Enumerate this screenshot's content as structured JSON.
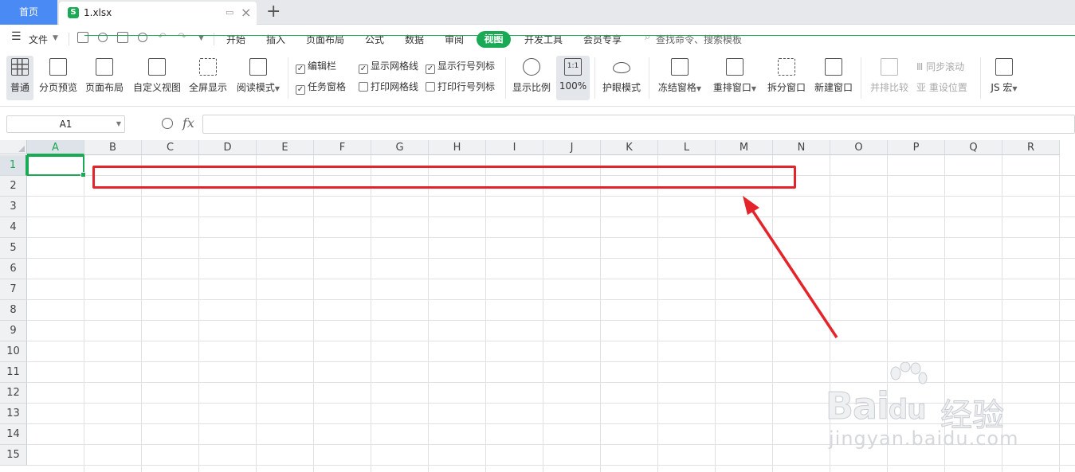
{
  "tabs": {
    "home": "首页",
    "file": "1.xlsx"
  },
  "menu": {
    "file": "文件",
    "items": [
      "开始",
      "插入",
      "页面布局",
      "公式",
      "数据",
      "审阅",
      "视图",
      "开发工具",
      "会员专享"
    ],
    "active": "视图",
    "search": "查找命令、搜索模板"
  },
  "ribbon": {
    "normal": "普通",
    "page_break": "分页预览",
    "page_layout": "页面布局",
    "custom_view": "自定义视图",
    "fullscreen": "全屏显示",
    "reading": "阅读模式",
    "checks": {
      "formula_bar": "编辑栏",
      "task_pane": "任务窗格",
      "show_grid": "显示网格线",
      "print_grid": "打印网格线",
      "show_headers": "显示行号列标",
      "print_headers": "打印行号列标"
    },
    "zoom": "显示比例",
    "zoom_pct": "100%",
    "zoom_icon": "1:1",
    "eye_mode": "护眼模式",
    "freeze": "冻结窗格",
    "rearrange": "重排窗口",
    "split": "拆分窗口",
    "new_window": "新建窗口",
    "side_by_side": "并排比较",
    "sync_scroll": "同步滚动",
    "reset_pos": "重设位置",
    "macro": "JS 宏"
  },
  "formula": {
    "cell": "A1",
    "fx": "fx",
    "value": ""
  },
  "grid": {
    "columns": [
      "A",
      "B",
      "C",
      "D",
      "E",
      "F",
      "G",
      "H",
      "I",
      "J",
      "K",
      "L",
      "M",
      "N",
      "O",
      "P",
      "Q",
      "R"
    ],
    "rows": [
      "1",
      "2",
      "3",
      "4",
      "5",
      "6",
      "7",
      "8",
      "9",
      "10",
      "11",
      "12",
      "13",
      "14",
      "15"
    ],
    "active_col": "A",
    "active_row": "1"
  },
  "watermark": {
    "logo": "Bai",
    "logo2": "du",
    "cn": "经验",
    "url": "jingyan.baidu.com"
  },
  "colors": {
    "accent": "#1aaa55",
    "home_tab": "#4a8af4",
    "annotation": "#e3242b"
  }
}
